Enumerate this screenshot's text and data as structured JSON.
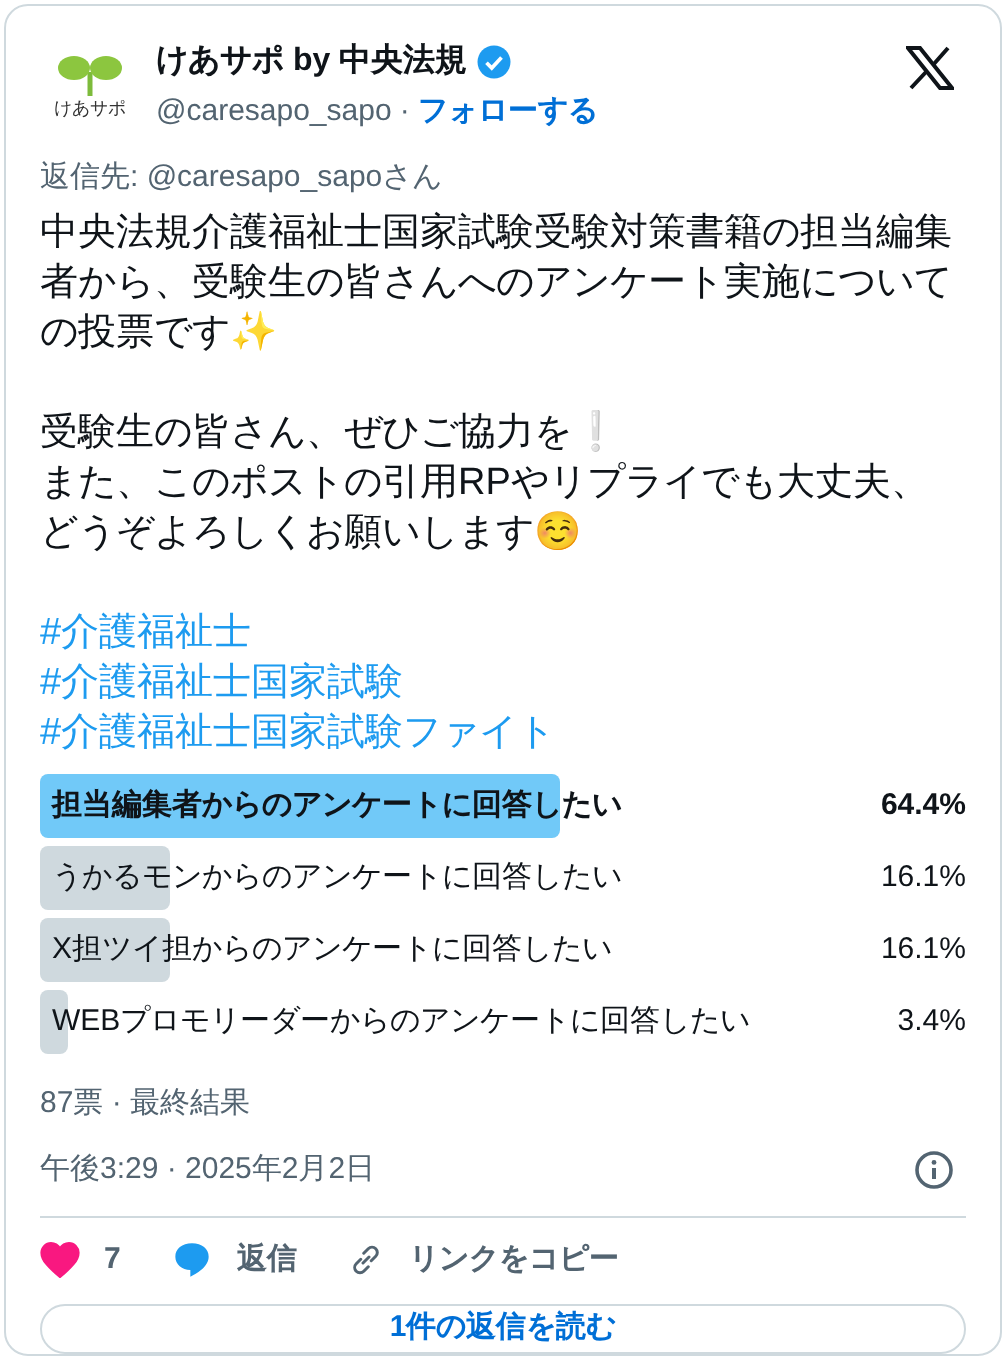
{
  "author": {
    "logo_text": "けあサポ",
    "name": "けあサポ by 中央法規",
    "verified": true,
    "handle": "@caresapo_sapo",
    "separator": "·",
    "follow": "フォローする"
  },
  "reply_to": "返信先: @caresapo_sapoさん",
  "body": [
    "中央法規介護福祉士国家試験受験対策書籍の担当編集者から、受験生の皆さんへのアンケート実施についての投票です✨",
    "受験生の皆さん、ぜひご協力を❕\nまた、このポストの引用RPやリプライでも大丈夫、どうぞよろしくお願いします☺️"
  ],
  "hashtags": [
    "#介護福祉士",
    "#介護福祉士国家試験",
    "#介護福祉士国家試験ファイト"
  ],
  "poll": {
    "options": [
      {
        "label": "担当編集者からのアンケートに回答したい",
        "percent": "64.4%",
        "leading": true
      },
      {
        "label": "うかるモンからのアンケートに回答したい",
        "percent": "16.1%",
        "leading": false
      },
      {
        "label": "X担ツイ担からのアンケートに回答したい",
        "percent": "16.1%",
        "leading": false
      },
      {
        "label": "WEBプロモリーダーからのアンケートに回答したい",
        "percent": "3.4%",
        "leading": false
      }
    ],
    "summary": "87票 · 最終結果"
  },
  "timestamp": "午後3:29 · 2025年2月2日",
  "actions": {
    "likes": "7",
    "liked": true,
    "reply": "返信",
    "copy_link": "リンクをコピー"
  },
  "read_replies": "1件の返信を読む"
}
